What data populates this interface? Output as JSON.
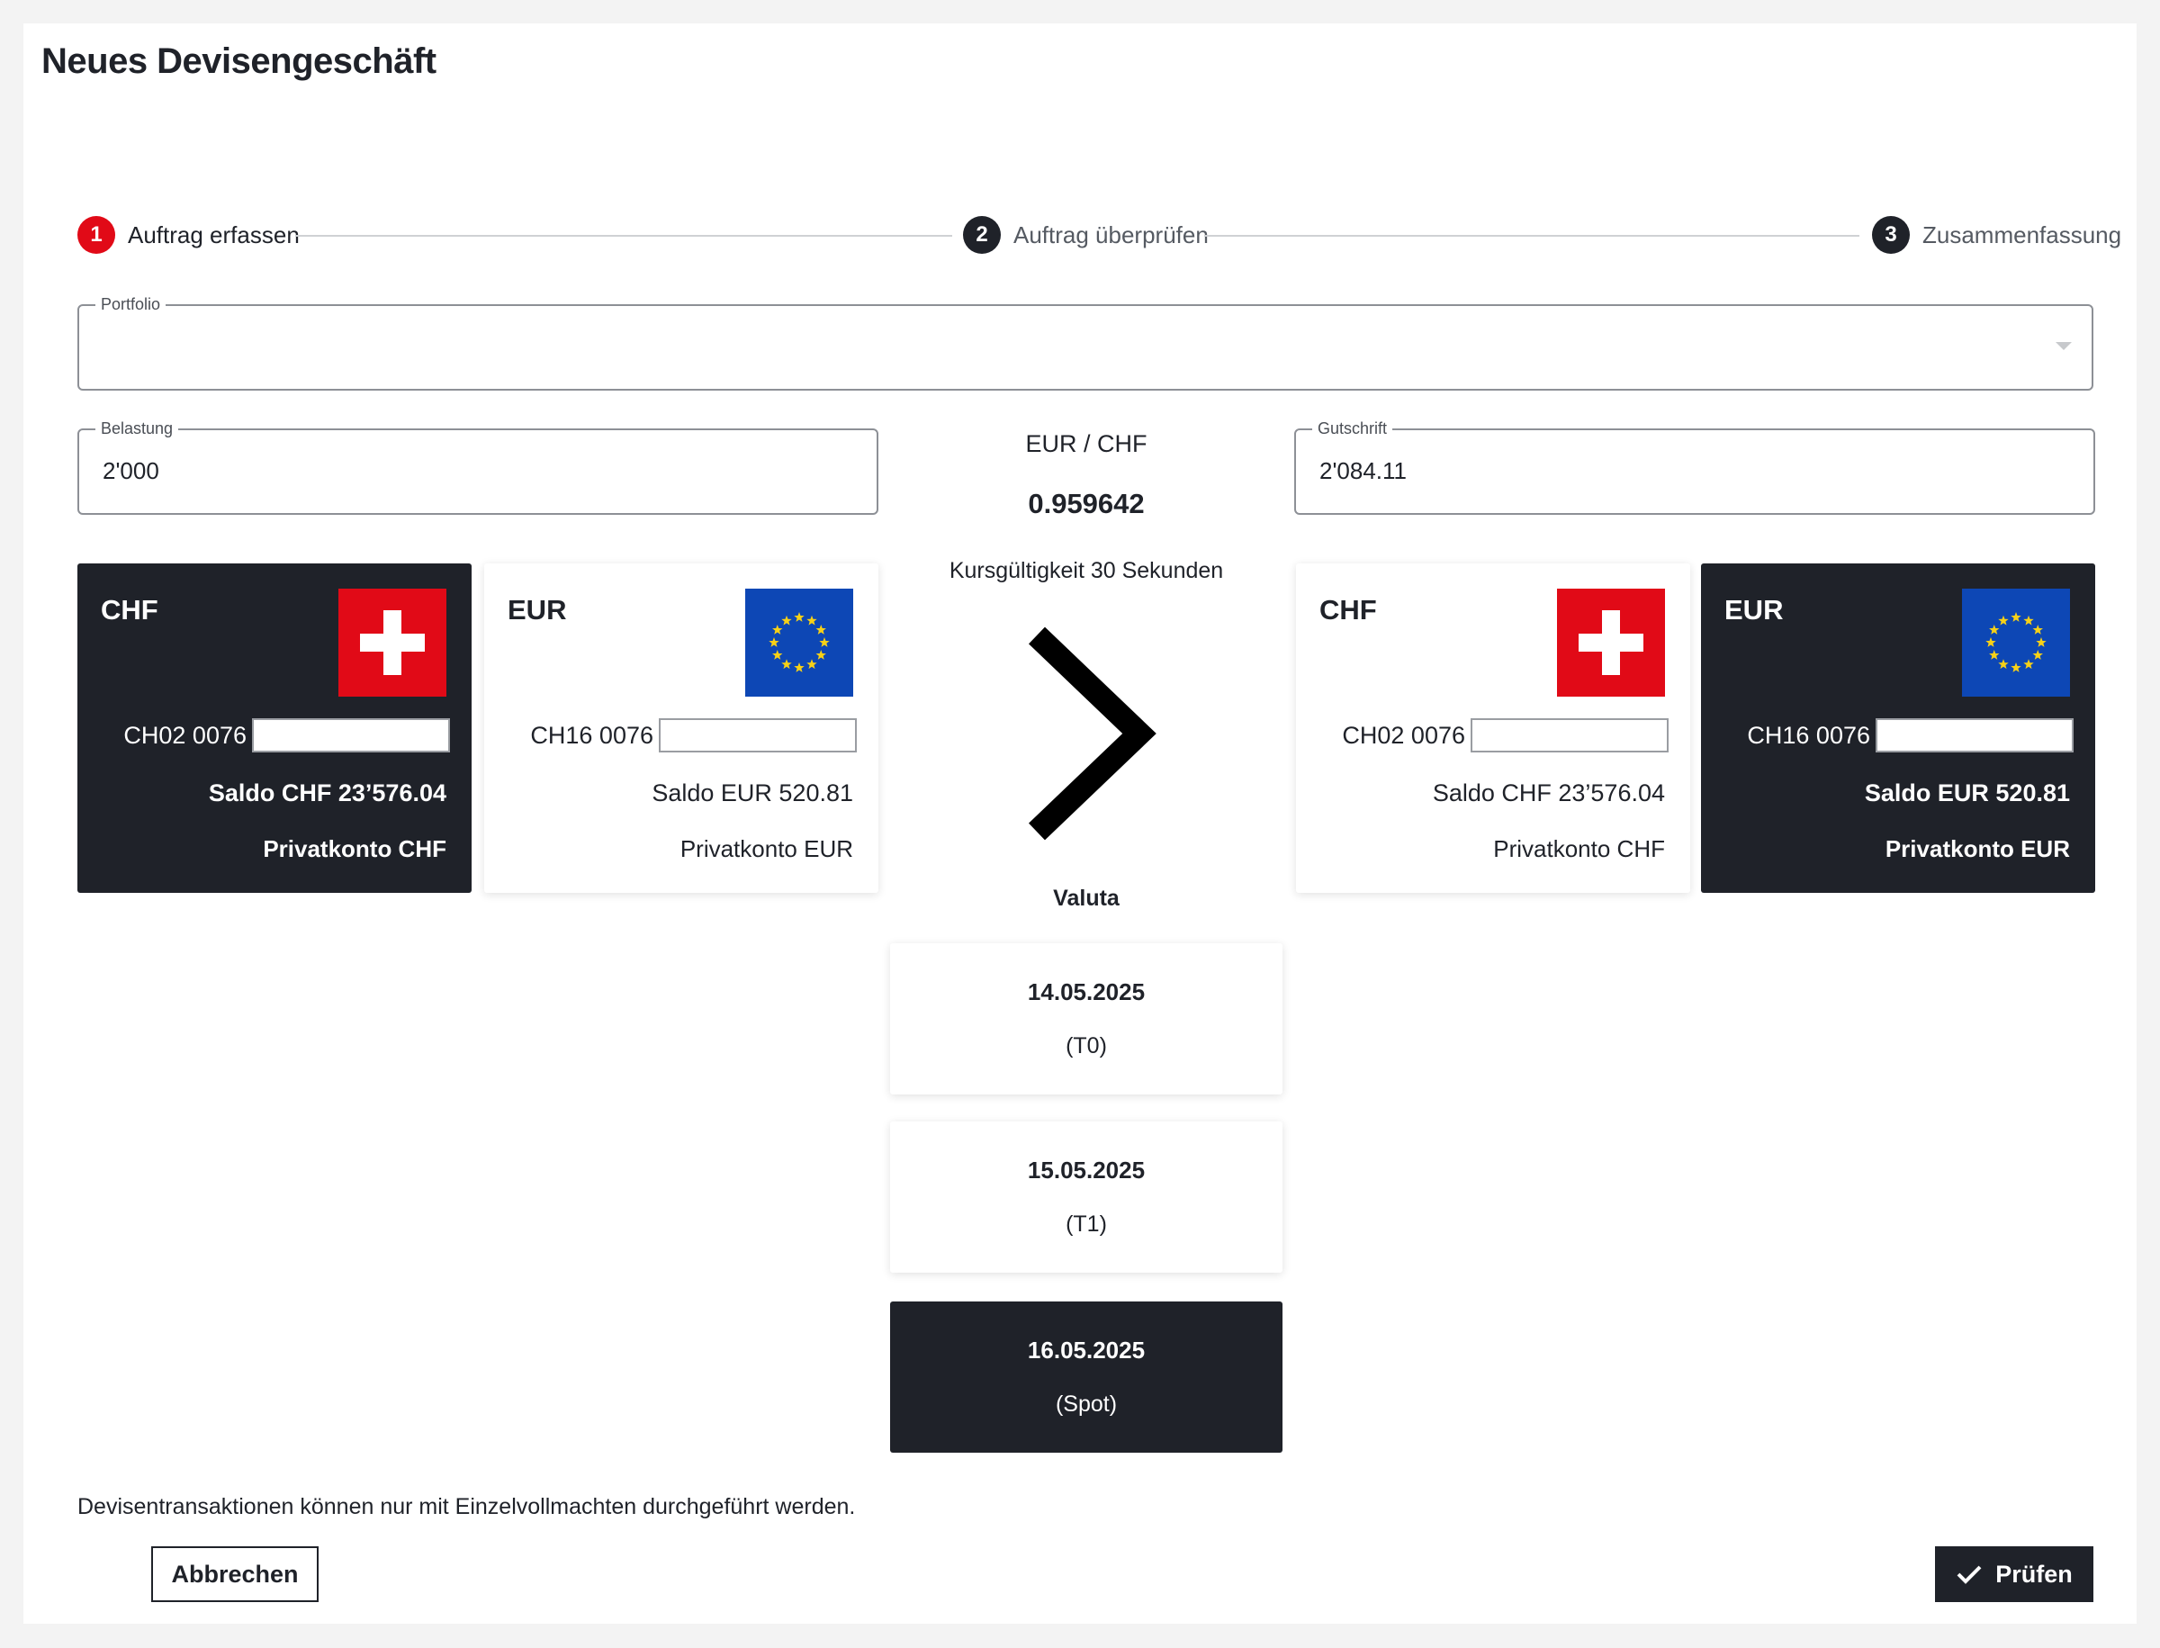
{
  "page": {
    "title": "Neues Devisengeschäft"
  },
  "stepper": {
    "steps": [
      {
        "number": "1",
        "label": "Auftrag erfassen",
        "active": true
      },
      {
        "number": "2",
        "label": "Auftrag überprüfen",
        "active": false
      },
      {
        "number": "3",
        "label": "Zusammenfassung",
        "active": false
      }
    ]
  },
  "form": {
    "portfolio": {
      "label": "Portfolio",
      "value": ""
    },
    "belastung": {
      "label": "Belastung",
      "value": "2'000"
    },
    "gutschrift": {
      "label": "Gutschrift",
      "value": "2'084.11"
    }
  },
  "rate": {
    "pair": "EUR / CHF",
    "value": "0.959642",
    "validity": "Kursgültigkeit 30 Sekunden"
  },
  "debit_accounts": [
    {
      "currency": "CHF",
      "flag": "swiss-flag-icon",
      "iban_prefix": "CH02 0076",
      "saldo": "Saldo CHF 23’576.04",
      "name": "Privatkonto CHF",
      "selected": true
    },
    {
      "currency": "EUR",
      "flag": "eu-flag-icon",
      "iban_prefix": "CH16 0076",
      "saldo": "Saldo EUR 520.81",
      "name": "Privatkonto EUR",
      "selected": false
    }
  ],
  "credit_accounts": [
    {
      "currency": "CHF",
      "flag": "swiss-flag-icon",
      "iban_prefix": "CH02 0076",
      "saldo": "Saldo CHF 23’576.04",
      "name": "Privatkonto CHF",
      "selected": false
    },
    {
      "currency": "EUR",
      "flag": "eu-flag-icon",
      "iban_prefix": "CH16 0076",
      "saldo": "Saldo EUR 520.81",
      "name": "Privatkonto EUR",
      "selected": true
    }
  ],
  "valuta": {
    "label": "Valuta",
    "options": [
      {
        "date": "14.05.2025",
        "tag": "(T0)",
        "selected": false
      },
      {
        "date": "15.05.2025",
        "tag": "(T1)",
        "selected": false
      },
      {
        "date": "16.05.2025",
        "tag": "(Spot)",
        "selected": true
      }
    ]
  },
  "footer": {
    "note": "Devisentransaktionen können nur mit Einzelvollmachten durchgeführt werden.",
    "cancel_label": "Abbrechen",
    "check_label": "Prüfen"
  },
  "colors": {
    "accent_red": "#e10a17",
    "dark": "#1f2229",
    "eu_blue": "#0d47b5",
    "eu_star": "#f7d117"
  }
}
